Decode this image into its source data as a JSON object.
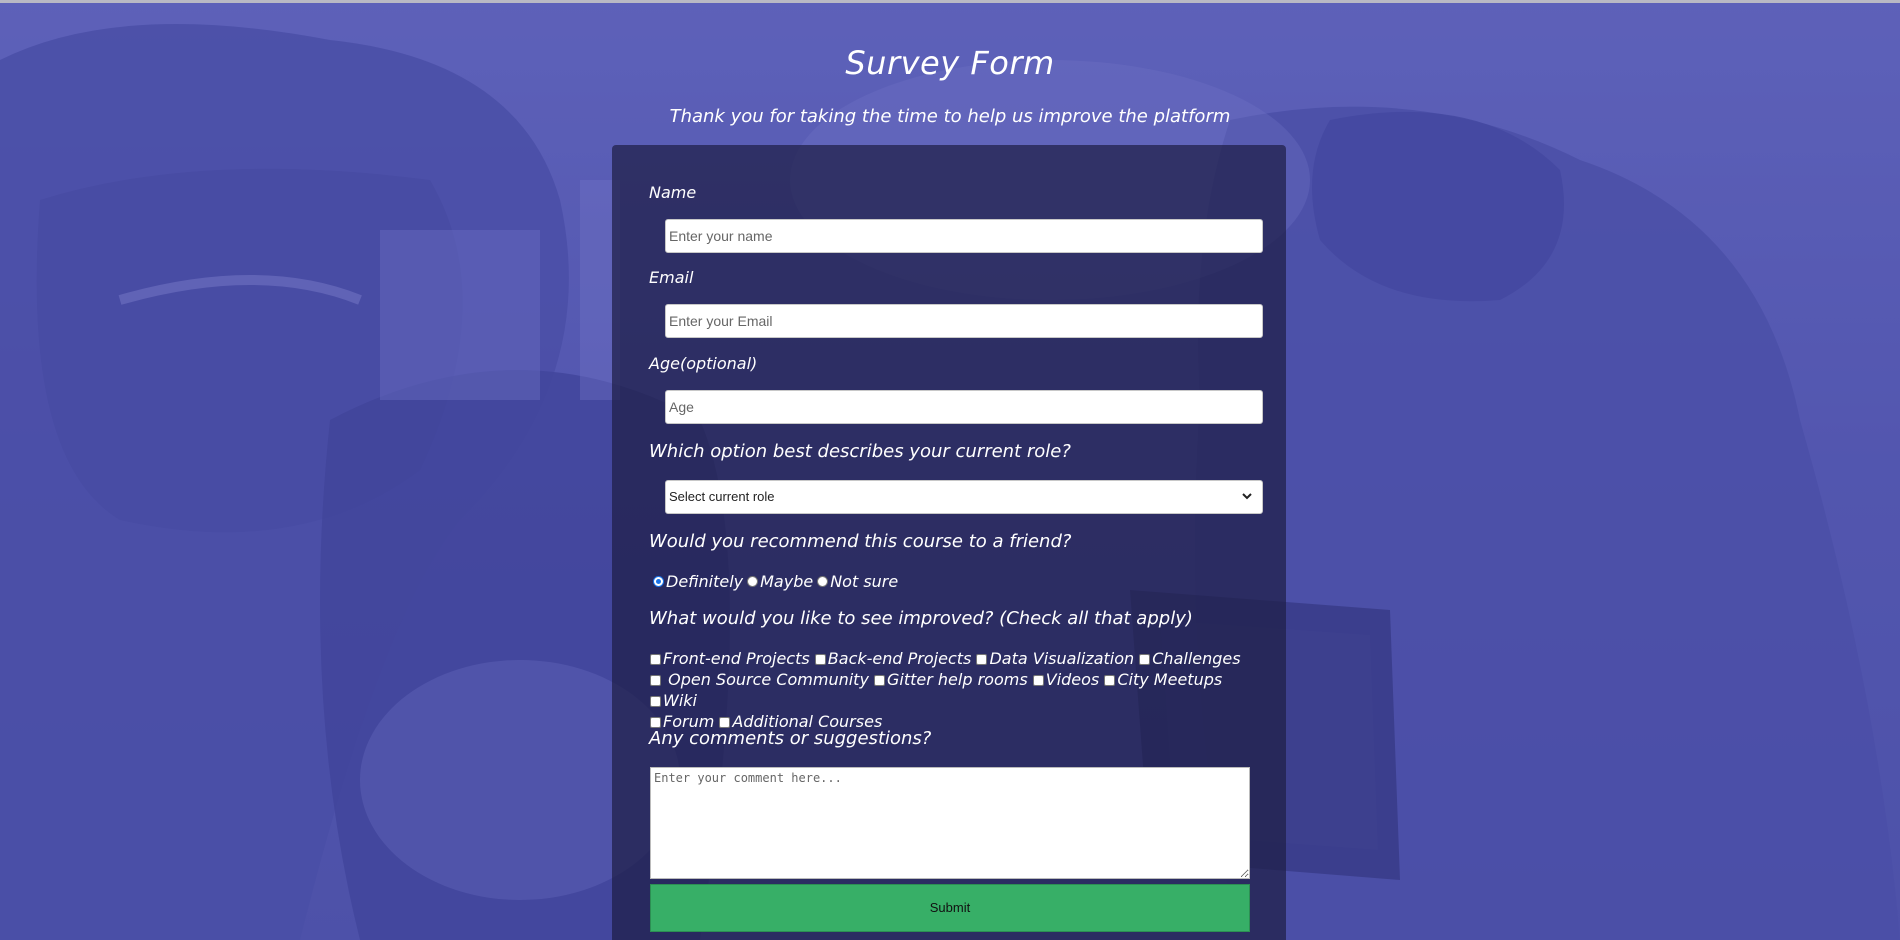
{
  "page": {
    "title": "Survey Form",
    "description": "Thank you for taking the time to help us improve the platform"
  },
  "form": {
    "name": {
      "label": "Name",
      "placeholder": "Enter your name"
    },
    "email": {
      "label": "Email",
      "placeholder": "Enter your Email"
    },
    "age": {
      "label": "Age(optional)",
      "placeholder": "Age"
    },
    "role": {
      "label": "Which option best describes your current role?",
      "selected": "Select current role"
    },
    "recommend": {
      "label": "Would you recommend this course to a friend?",
      "options": [
        "Definitely",
        "Maybe",
        "Not sure"
      ],
      "selected": "Definitely"
    },
    "improve": {
      "label": "What would you like to see improved? (Check all that apply)",
      "options": [
        "Front-end Projects",
        "Back-end Projects",
        "Data Visualization",
        "Challenges",
        "Open Source Community",
        "Gitter help rooms",
        "Videos",
        "City Meetups",
        "Wiki",
        "Forum",
        "Additional Courses"
      ]
    },
    "comments": {
      "label": "Any comments or suggestions?",
      "placeholder": "Enter your comment here..."
    },
    "submit_label": "Submit"
  },
  "colors": {
    "overlay": "#5b5fb4",
    "card": "#1e1e46",
    "submit": "#37af67"
  },
  "icons": {
    "select_chevron": "chevron-down-icon"
  }
}
